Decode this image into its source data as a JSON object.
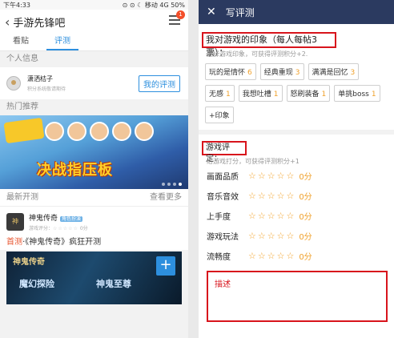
{
  "left": {
    "status": {
      "time": "下午4:33",
      "icons": "⊙ ⊙ ☾ 移动 4G 50%"
    },
    "header": {
      "title": "手游先锋吧",
      "badge_count": "1"
    },
    "tabs": [
      "看贴",
      "评测"
    ],
    "active_tab": 1,
    "personal_section": "个人信息",
    "user": {
      "name": "潇洒桔子",
      "hint": "积分系统敬请期待"
    },
    "my_review_label": "我的评测",
    "hot_section": "热门推荐",
    "banner": {
      "slogan": "决战指压板"
    },
    "latest": {
      "label": "最新开测",
      "more": "查看更多"
    },
    "game": {
      "name": "神鬼传奇",
      "tag": "角色扮演",
      "score_label": "游戏评分：",
      "score": "0分"
    },
    "headline": {
      "hot": "首测",
      "text": "·《神鬼传奇》疯狂开测"
    },
    "bigimg": {
      "t1": "神鬼传奇",
      "t2": "魔幻探险",
      "t3": "神鬼至尊"
    },
    "plus_label": "+"
  },
  "right": {
    "header": {
      "close": "✕",
      "title": "写评测"
    },
    "impression": {
      "title": "我对游戏的印象（每人每帖3票）：",
      "hint": "选择游戏印象，可获得评测积分+2.",
      "tags": [
        {
          "label": "玩的是情怀",
          "count": "6"
        },
        {
          "label": "经典重现",
          "count": "3"
        },
        {
          "label": "满满是回忆",
          "count": "3"
        },
        {
          "label": "无感",
          "count": "1"
        },
        {
          "label": "我想吐槽",
          "count": "1"
        },
        {
          "label": "怒刷装备",
          "count": "1"
        },
        {
          "label": "单挑boss",
          "count": "1"
        },
        {
          "label": "+印象",
          "count": ""
        }
      ]
    },
    "rating": {
      "title": "游戏评定：",
      "hint": "给游戏打分，可获得评测积分+1",
      "rows": [
        {
          "label": "画面品质",
          "stars": "☆☆☆☆☆",
          "score": "0分"
        },
        {
          "label": "音乐音效",
          "stars": "☆☆☆☆☆",
          "score": "0分"
        },
        {
          "label": "上手度",
          "stars": "☆☆☆☆☆",
          "score": "0分"
        },
        {
          "label": "游戏玩法",
          "stars": "☆☆☆☆☆",
          "score": "0分"
        },
        {
          "label": "流畅度",
          "stars": "☆☆☆☆☆",
          "score": "0分"
        }
      ]
    },
    "description_label": "描述"
  }
}
